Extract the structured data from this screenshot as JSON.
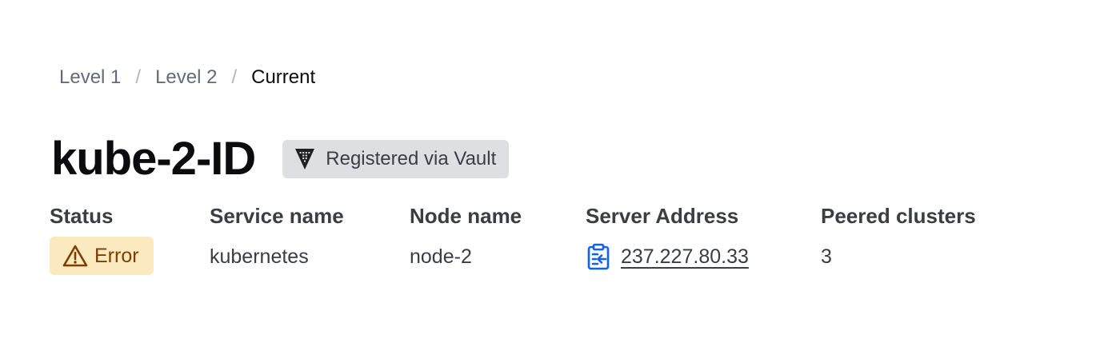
{
  "breadcrumb": {
    "items": [
      "Level 1",
      "Level 2"
    ],
    "separator": "/",
    "current": "Current"
  },
  "header": {
    "title": "kube-2-ID",
    "badge": {
      "label": "Registered via Vault",
      "icon": "vault-icon"
    }
  },
  "metadata": {
    "status": {
      "label": "Status",
      "value": "Error",
      "icon": "alert-triangle-icon",
      "color": "#fbeabf"
    },
    "service": {
      "label": "Service name",
      "value": "kubernetes"
    },
    "node": {
      "label": "Node name",
      "value": "node-2"
    },
    "server": {
      "label": "Server Address",
      "value": "237.227.80.33",
      "icon": "clipboard-copy-icon",
      "icon_color": "#1060ff"
    },
    "peered": {
      "label": "Peered clusters",
      "value": "3"
    }
  }
}
